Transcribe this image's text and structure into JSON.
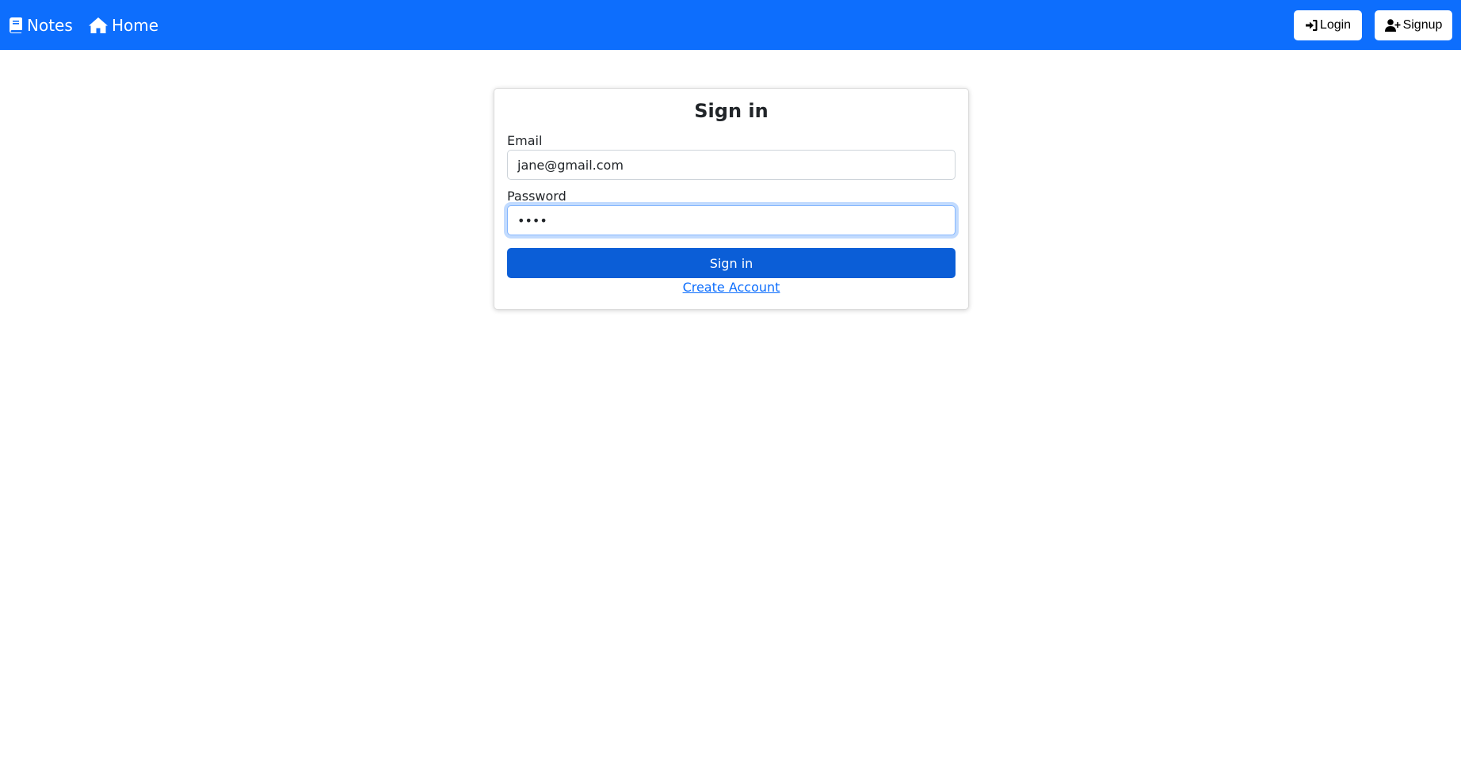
{
  "navbar": {
    "brand_label": "Notes",
    "home_label": "Home",
    "login_label": "Login",
    "signup_label": "Signup",
    "background_color": "#0d6efd",
    "icons": {
      "brand": "book-icon",
      "home": "home-icon",
      "login": "sign-in-icon",
      "signup": "user-plus-icon"
    }
  },
  "signin_card": {
    "title": "Sign in",
    "email_label": "Email",
    "email_value": "jane@gmail.com",
    "password_label": "Password",
    "password_value": "1234",
    "submit_label": "Sign in",
    "create_account_label": "Create Account",
    "button_color": "#0b5ed7",
    "link_color": "#0d6efd"
  }
}
